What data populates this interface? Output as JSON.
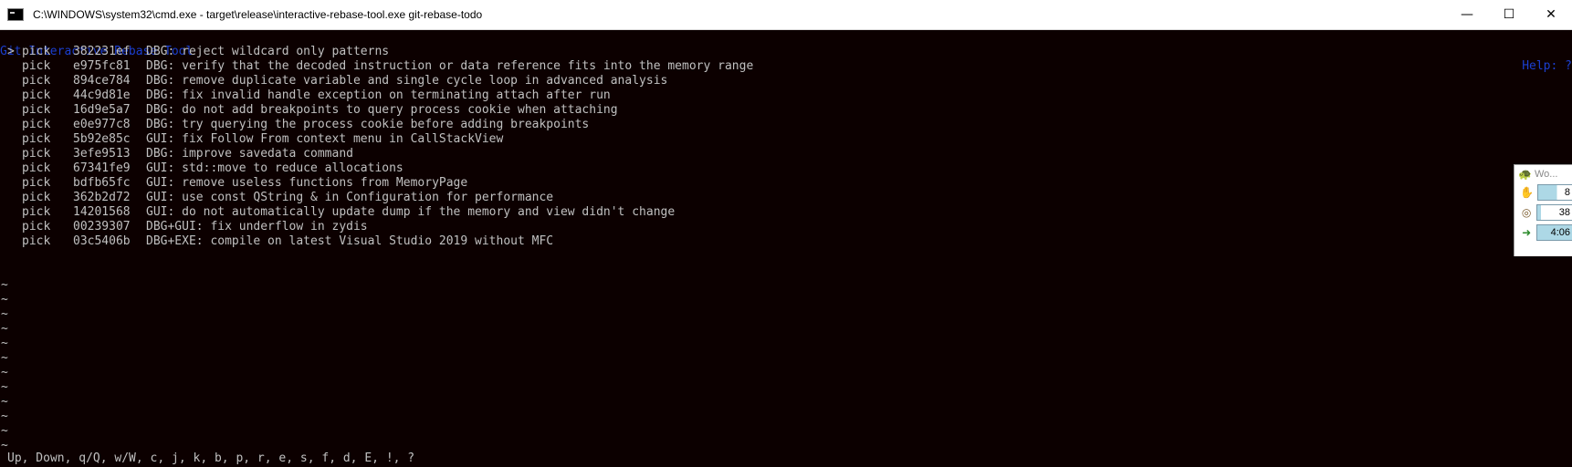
{
  "window": {
    "title": "C:\\WINDOWS\\system32\\cmd.exe - target\\release\\interactive-rebase-tool.exe  git-rebase-todo",
    "controls": {
      "minimize": "—",
      "maximize": "☐",
      "close": "✕"
    }
  },
  "header": {
    "title": "Git Interactive Rebase Tool",
    "help": "Help: ?"
  },
  "cursor": ">",
  "rows": [
    {
      "action": "pick",
      "hash": "382231ef",
      "message": "DBG: reject wildcard only patterns",
      "selected": true
    },
    {
      "action": "pick",
      "hash": "e975fc81",
      "message": "DBG: verify that the decoded instruction or data reference fits into the memory range"
    },
    {
      "action": "pick",
      "hash": "894ce784",
      "message": "DBG: remove duplicate variable and single cycle loop in advanced analysis"
    },
    {
      "action": "pick",
      "hash": "44c9d81e",
      "message": "DBG: fix invalid handle exception on terminating attach after run"
    },
    {
      "action": "pick",
      "hash": "16d9e5a7",
      "message": "DBG: do not add breakpoints to query process cookie when attaching"
    },
    {
      "action": "pick",
      "hash": "e0e977c8",
      "message": "DBG: try querying the process cookie before adding breakpoints"
    },
    {
      "action": "pick",
      "hash": "5b92e85c",
      "message": "GUI: fix Follow From context menu in CallStackView"
    },
    {
      "action": "pick",
      "hash": "3efe9513",
      "message": "DBG: improve savedata command"
    },
    {
      "action": "pick",
      "hash": "67341fe9",
      "message": "GUI: std::move to reduce allocations"
    },
    {
      "action": "pick",
      "hash": "bdfb65fc",
      "message": "GUI: remove useless functions from MemoryPage"
    },
    {
      "action": "pick",
      "hash": "362b2d72",
      "message": "GUI: use const QString & in Configuration for performance"
    },
    {
      "action": "pick",
      "hash": "14201568",
      "message": "GUI: do not automatically update dump if the memory and view didn't change"
    },
    {
      "action": "pick",
      "hash": "00239307",
      "message": "DBG+GUI: fix underflow in zydis"
    },
    {
      "action": "pick",
      "hash": "03c5406b",
      "message": "DBG+EXE: compile on latest Visual Studio 2019 without MFC"
    }
  ],
  "tilde_char": "~",
  "tilde_count": 12,
  "footer": "Up, Down, q/Q, w/W, c, j, k, b, p, r, e, s, f, d, E, !, ?",
  "widget": {
    "title": "Wo...",
    "rows": [
      {
        "icon": "hand-icon",
        "glyph": "✋",
        "value": "8",
        "fill": 0.55
      },
      {
        "icon": "coins-icon",
        "glyph": "◎",
        "value": "38",
        "fill": 0.1
      },
      {
        "icon": "exit-icon",
        "glyph": "➜",
        "value": "4:06",
        "fill": 1.0
      }
    ]
  },
  "colors": {
    "background": "#0c0000",
    "text": "#c0c0c0",
    "header": "#1b3fd0",
    "widget_bar": "#add8e6"
  }
}
